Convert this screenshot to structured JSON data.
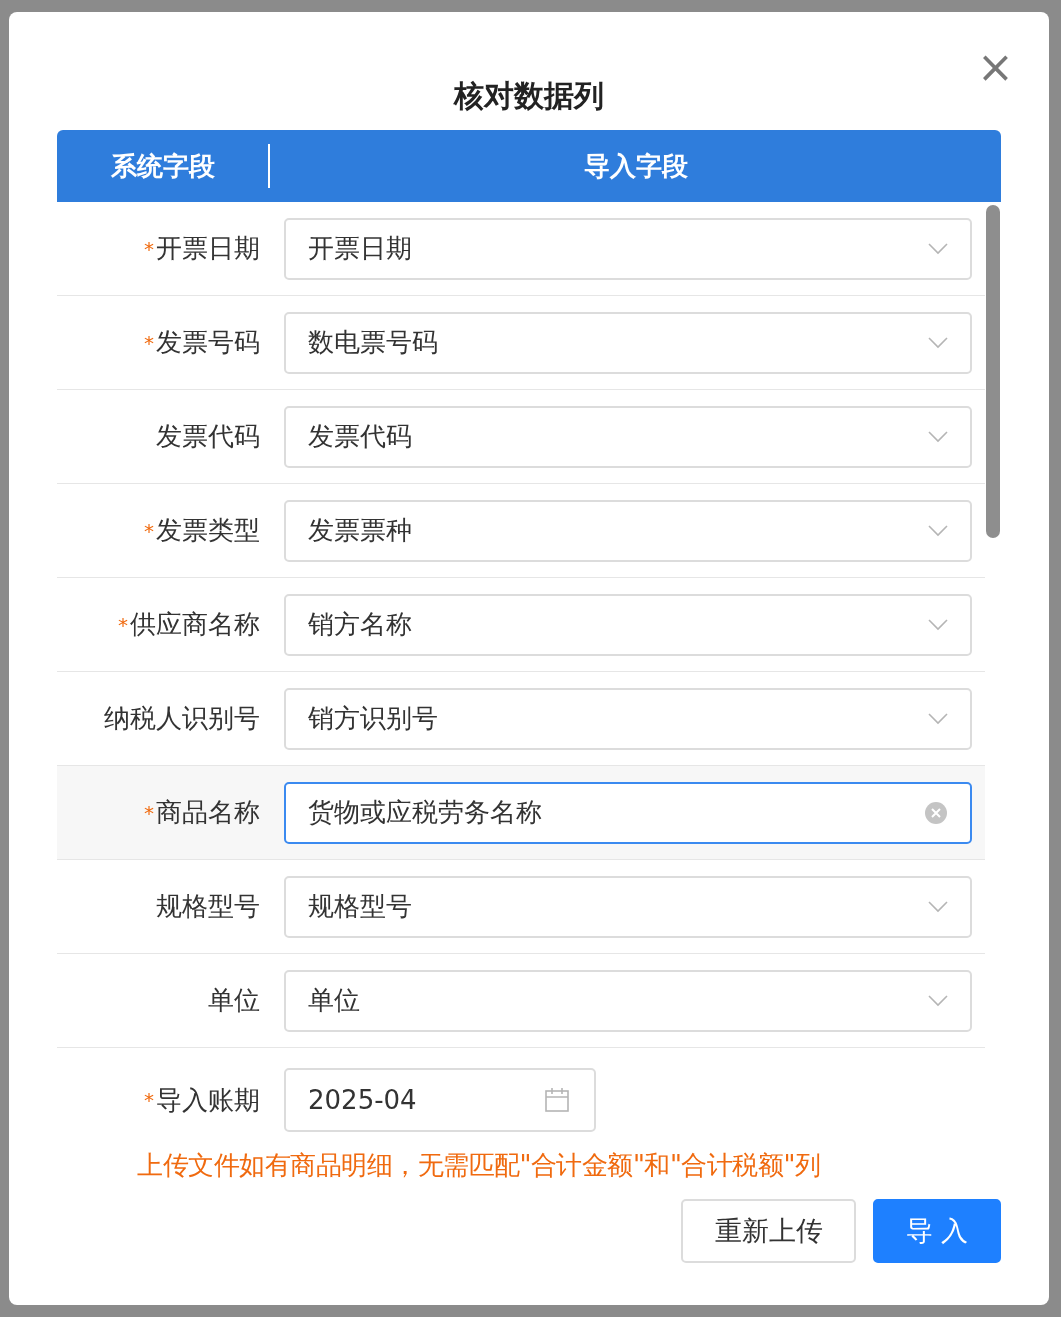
{
  "dialog": {
    "title": "核对数据列",
    "close": "×"
  },
  "table_header": {
    "column_1": "系统字段",
    "column_2": "导入字段"
  },
  "rows": [
    {
      "required_mark": "*",
      "label": "开票日期",
      "value": "开票日期",
      "focused": false
    },
    {
      "required_mark": "*",
      "label": "发票号码",
      "value": "数电票号码",
      "focused": false
    },
    {
      "label": "发票代码",
      "value": "发票代码",
      "focused": false
    },
    {
      "required_mark": "*",
      "label": "发票类型",
      "value": "发票票种",
      "focused": false
    },
    {
      "required_mark": "*",
      "label": "供应商名称",
      "value": "销方名称",
      "focused": false
    },
    {
      "label": "纳税人识别号",
      "value": "销方识别号",
      "focused": false
    },
    {
      "required_mark": "*",
      "label": "商品名称",
      "value": "货物或应税劳务名称",
      "focused": true
    },
    {
      "label": "规格型号",
      "value": "规格型号",
      "focused": false
    },
    {
      "label": "单位",
      "value": "单位",
      "focused": false
    }
  ],
  "period": {
    "required_mark": "*",
    "label": "导入账期",
    "value": "2025-04"
  },
  "notice": "上传文件如有商品明细，无需匹配\"合计金额\"和\"合计税额\"列",
  "buttons": [
    {
      "label": "重新上传",
      "kind": "secondary"
    },
    {
      "label": "导 入",
      "kind": "primary"
    }
  ]
}
